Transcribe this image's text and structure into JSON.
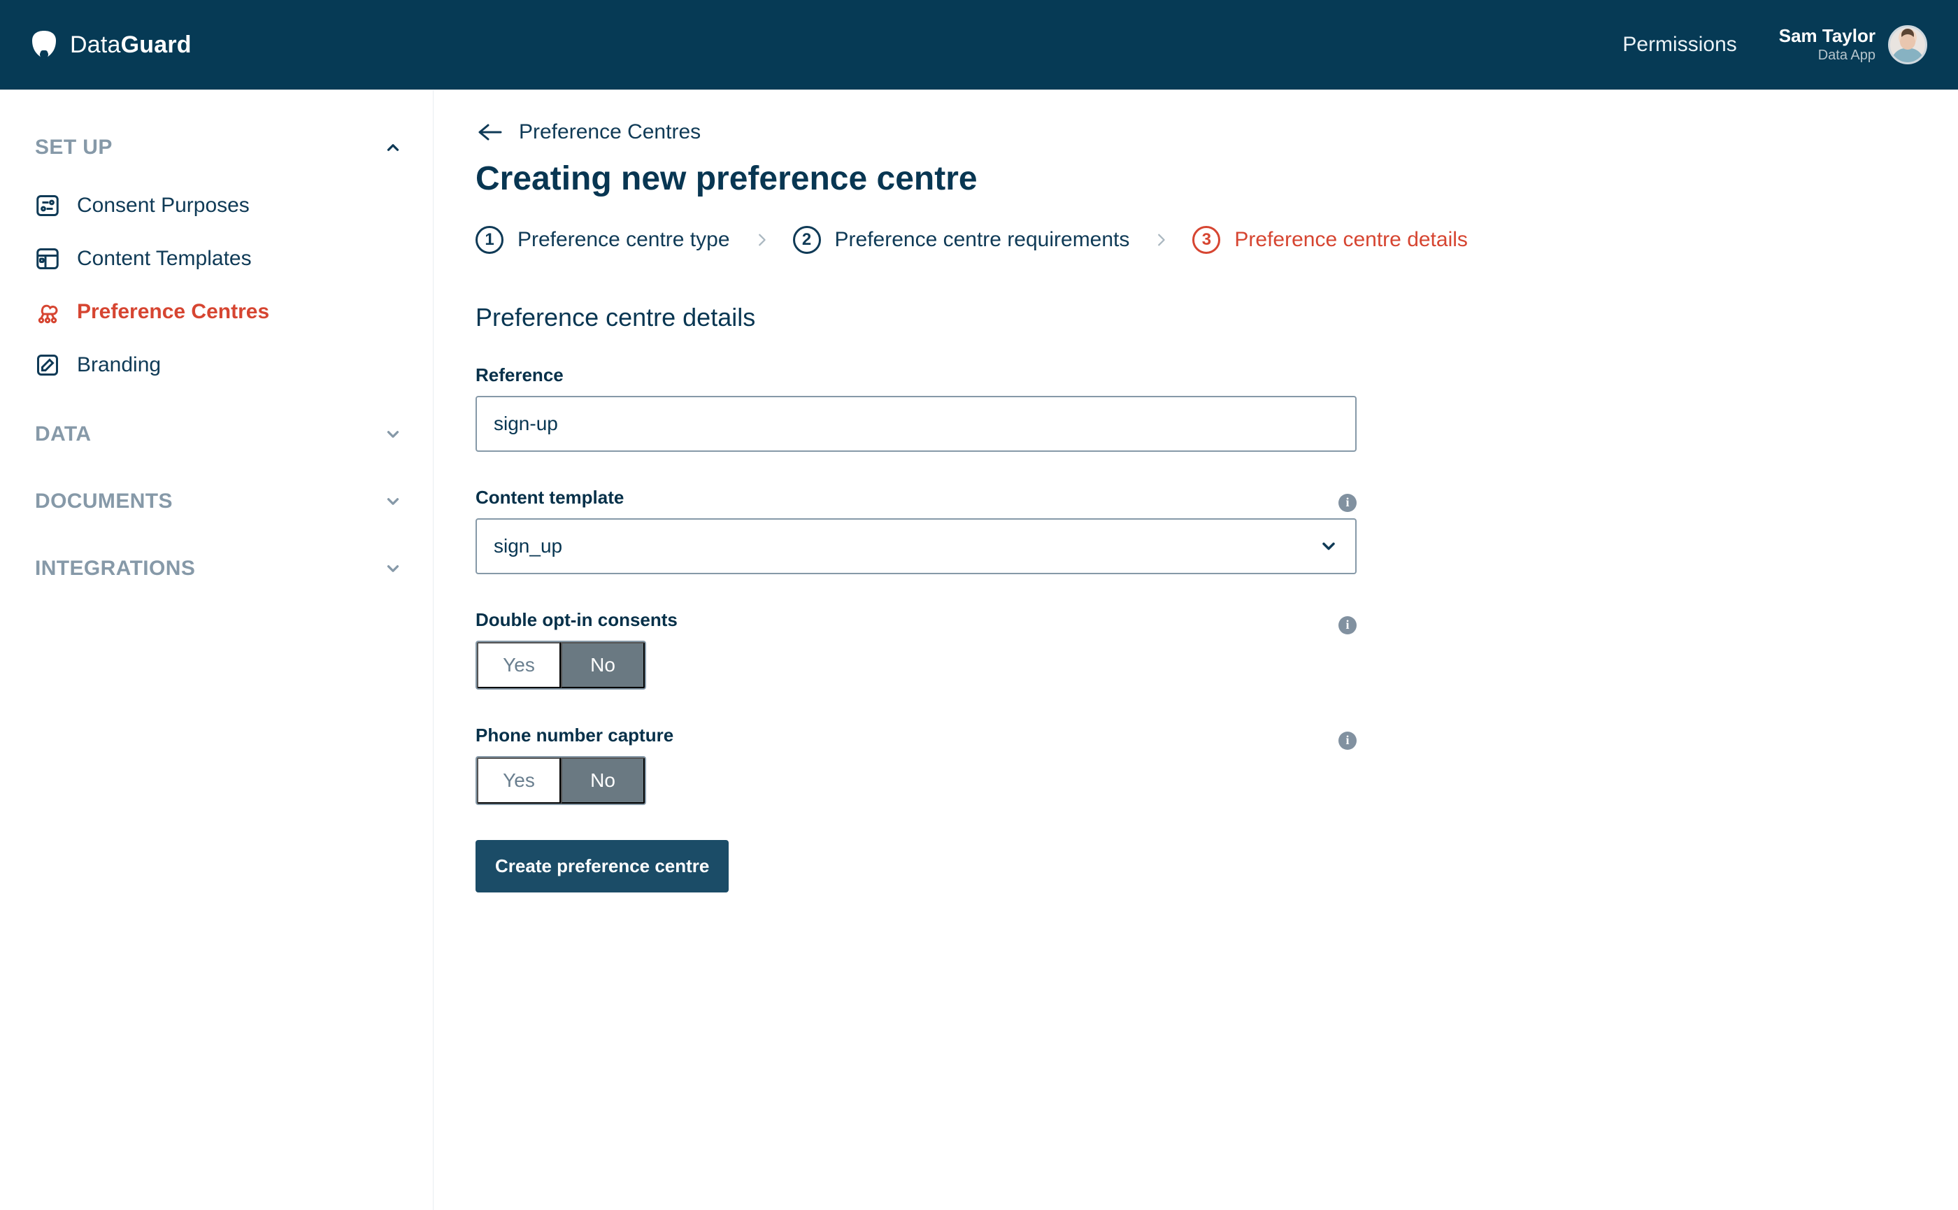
{
  "brand": {
    "light": "Data",
    "bold": "Guard"
  },
  "header": {
    "permissions": "Permissions",
    "user_name": "Sam Taylor",
    "user_sub": "Data App"
  },
  "sidebar": {
    "sections": {
      "setup": {
        "label": "SET UP",
        "expanded": true
      },
      "data": {
        "label": "DATA",
        "expanded": false
      },
      "documents": {
        "label": "DOCUMENTS",
        "expanded": false
      },
      "integrations": {
        "label": "INTEGRATIONS",
        "expanded": false
      }
    },
    "items": [
      {
        "label": "Consent Purposes",
        "icon": "sliders-icon",
        "active": false
      },
      {
        "label": "Content Templates",
        "icon": "layout-icon",
        "active": false
      },
      {
        "label": "Preference Centres",
        "icon": "cloud-nodes-icon",
        "active": true
      },
      {
        "label": "Branding",
        "icon": "pencil-icon",
        "active": false
      }
    ]
  },
  "crumb": {
    "label": "Preference Centres"
  },
  "page": {
    "title": "Creating new preference centre"
  },
  "stepper": {
    "steps": [
      {
        "num": "1",
        "label": "Preference centre type",
        "active": false
      },
      {
        "num": "2",
        "label": "Preference centre requirements",
        "active": false
      },
      {
        "num": "3",
        "label": "Preference centre details",
        "active": true
      }
    ]
  },
  "section_title": "Preference centre details",
  "form": {
    "reference": {
      "label": "Reference",
      "value": "sign-up"
    },
    "template": {
      "label": "Content template",
      "value": "sign_up"
    },
    "double_optin": {
      "label": "Double opt-in consents",
      "yes": "Yes",
      "no": "No",
      "value": "No"
    },
    "phone_capture": {
      "label": "Phone number capture",
      "yes": "Yes",
      "no": "No",
      "value": "No"
    },
    "submit_label": "Create preference centre"
  }
}
